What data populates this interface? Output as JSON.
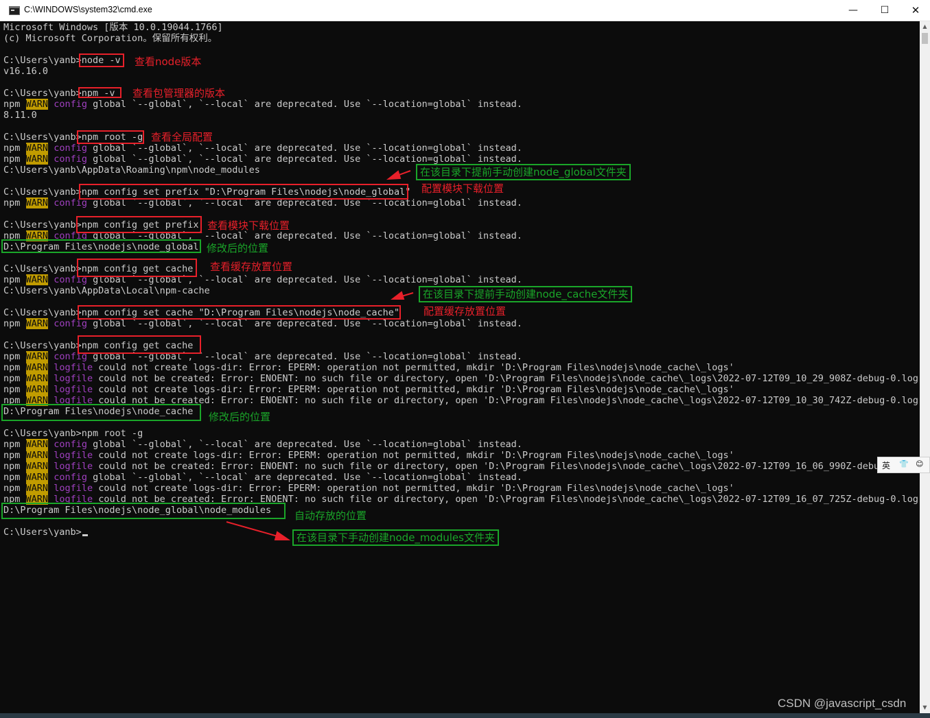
{
  "window": {
    "title": "C:\\WINDOWS\\system32\\cmd.exe",
    "controls": {
      "minimize": "—",
      "maximize": "☐",
      "close": "✕"
    }
  },
  "console": {
    "colors": {
      "background": "#0c0c0c",
      "text": "#cccccc",
      "warn_bg": "#c19c00",
      "magenta": "#a040c0",
      "annotation_red": "#e8202a",
      "annotation_green": "#1aa629"
    },
    "lines": {
      "l1": "Microsoft Windows [版本 10.0.19044.1766]",
      "l2": "(c) Microsoft Corporation。保留所有权利。",
      "l4": "C:\\Users\\yanb>node -v",
      "l5": "v16.16.0",
      "l7": "C:\\Users\\yanb>npm -v",
      "l9": "8.11.0",
      "l11": "C:\\Users\\yanb>npm root -g",
      "l14": "C:\\Users\\yanb\\AppData\\Roaming\\npm\\node_modules",
      "l16": "C:\\Users\\yanb>npm config set prefix \"D:\\Program Files\\nodejs\\node_global\"",
      "l19": "C:\\Users\\yanb>npm config get prefix",
      "l21": "D:\\Program Files\\nodejs\\node_global",
      "l23": "C:\\Users\\yanb>npm config get cache",
      "l25": "C:\\Users\\yanb\\AppData\\Local\\npm-cache",
      "l27": "C:\\Users\\yanb>npm config set cache \"D:\\Program Files\\nodejs\\node_cache\"",
      "l30": "C:\\Users\\yanb>npm config get cache",
      "l36": "D:\\Program Files\\nodejs\\node_cache",
      "l38": "C:\\Users\\yanb>npm root -g",
      "l45": "D:\\Program Files\\nodejs\\node_global\\node_modules",
      "l47": "C:\\Users\\yanb>"
    },
    "npm": {
      "prefix": "npm",
      "warn": "WARN",
      "config": "config",
      "logfile": "logfile",
      "deprecated": " global `--global`, `--local` are deprecated. Use `--location=global` instead.",
      "mkdir_cache": " could not create logs-dir: Error: EPERM: operation not permitted, mkdir 'D:\\Program Files\\nodejs\\node_cache\\_logs'",
      "created_1": " could not be created: Error: ENOENT: no such file or directory, open 'D:\\Program Files\\nodejs\\node_cache\\_logs\\2022-07-12T09_10_29_908Z-debug-0.log'",
      "created_2": " could not be created: Error: ENOENT: no such file or directory, open 'D:\\Program Files\\nodejs\\node_cache\\_logs\\2022-07-12T09_10_30_742Z-debug-0.log'",
      "created_3": " could not be created: Error: ENOENT: no such file or directory, open 'D:\\Program Files\\nodejs\\node_cache\\_logs\\2022-07-12T09_16_06_990Z-debug-",
      "created_4": " could not be created: Error: ENOENT: no such file or directory, open 'D:\\Program Files\\nodejs\\node_cache\\_logs\\2022-07-12T09_16_07_725Z-debug-0.log'"
    }
  },
  "annotations": {
    "node_version": "查看node版本",
    "pkg_version": "查看包管理器的版本",
    "global_config": "查看全局配置",
    "create_global": "在该目录下提前手动创建node_global文件夹",
    "set_prefix": "配置模块下载位置",
    "get_prefix": "查看模块下载位置",
    "modified_1": "修改后的位置",
    "get_cache": "查看缓存放置位置",
    "create_cache": "在该目录下提前手动创建node_cache文件夹",
    "set_cache": "配置缓存放置位置",
    "modified_2": "修改后的位置",
    "auto_location": "自动存放的位置",
    "create_modules": "在该目录下手动创建node_modules文件夹"
  },
  "ime": {
    "lang": "英",
    "shirt": "👕",
    "emoji": "😊"
  },
  "watermark": "CSDN @javascript_csdn",
  "scrollbar": {
    "up": "▲",
    "down": "▼"
  }
}
